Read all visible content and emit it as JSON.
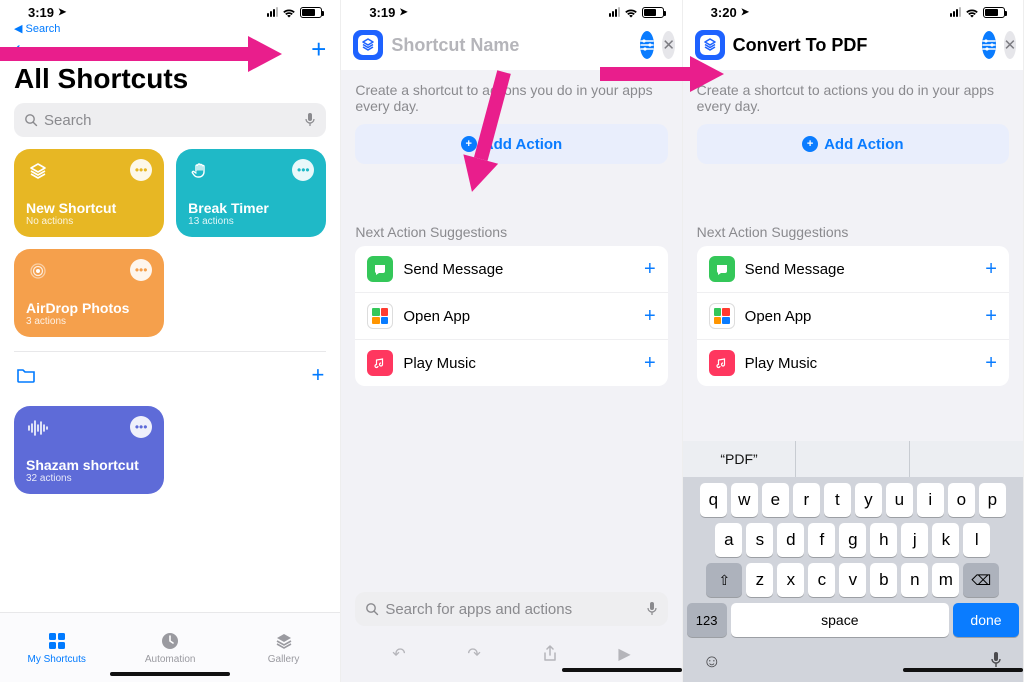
{
  "statusbar": {
    "time1": "3:19",
    "time2": "3:19",
    "time3": "3:20",
    "back": "Search"
  },
  "screen1": {
    "title": "All Shortcuts",
    "search_placeholder": "Search",
    "tiles": {
      "new_shortcut": {
        "name": "New Shortcut",
        "sub": "No actions"
      },
      "break_timer": {
        "name": "Break Timer",
        "sub": "13 actions"
      },
      "airdrop": {
        "name": "AirDrop Photos",
        "sub": "3 actions"
      },
      "shazam": {
        "name": "Shazam shortcut",
        "sub": "32 actions"
      }
    },
    "tabs": {
      "my": "My Shortcuts",
      "automation": "Automation",
      "gallery": "Gallery"
    }
  },
  "editor": {
    "placeholder": "Shortcut Name",
    "name_value": "Convert To PDF",
    "description": "Create a shortcut to actions you do in your apps every day.",
    "add_action": "Add Action",
    "suggestions_label": "Next Action Suggestions",
    "suggestions": {
      "send_message": "Send Message",
      "open_app": "Open App",
      "play_music": "Play Music"
    },
    "search_actions_placeholder": "Search for apps and actions"
  },
  "keyboard": {
    "suggestion": "“PDF”",
    "row1": [
      "q",
      "w",
      "e",
      "r",
      "t",
      "y",
      "u",
      "i",
      "o",
      "p"
    ],
    "row2": [
      "a",
      "s",
      "d",
      "f",
      "g",
      "h",
      "j",
      "k",
      "l"
    ],
    "row3": [
      "z",
      "x",
      "c",
      "v",
      "b",
      "n",
      "m"
    ],
    "numbers": "123",
    "space": "space",
    "done": "done"
  }
}
